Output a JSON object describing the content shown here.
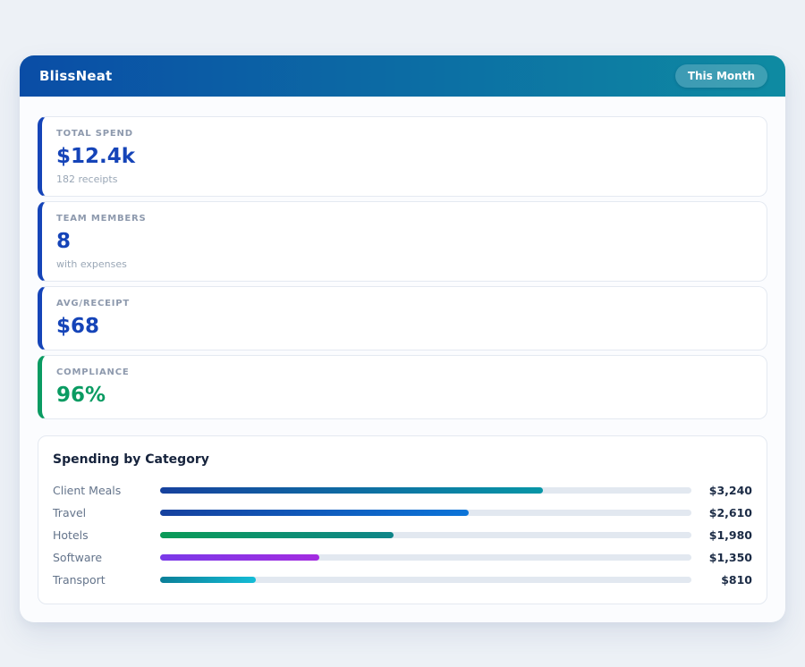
{
  "header": {
    "app_name": "BlissNeat",
    "badge": "This Month",
    "gradient_from": "#0a4da6",
    "gradient_to": "#0e8ba2"
  },
  "stats": [
    {
      "label": "TOTAL SPEND",
      "value": "$12.4k",
      "sub": "182 receipts",
      "accent": "#1544b8",
      "value_color": "#1544b8"
    },
    {
      "label": "TEAM MEMBERS",
      "value": "8",
      "sub": "with expenses",
      "accent": "#1544b8",
      "value_color": "#1544b8"
    },
    {
      "label": "AVG/RECEIPT",
      "value": "$68",
      "sub": "",
      "accent": "#1544b8",
      "value_color": "#1544b8"
    },
    {
      "label": "COMPLIANCE",
      "value": "96%",
      "sub": "",
      "accent": "#0a9b62",
      "value_color": "#0a9b62"
    }
  ],
  "spending": {
    "title": "Spending by Category",
    "max": 4500,
    "track_color": "#e2e8f0",
    "rows": [
      {
        "label": "Client Meals",
        "value": 3240,
        "value_label": "$3,240",
        "gradient": [
          "#16419e",
          "#0796a6"
        ]
      },
      {
        "label": "Travel",
        "value": 2610,
        "value_label": "$2,610",
        "gradient": [
          "#16419e",
          "#0b74d8"
        ]
      },
      {
        "label": "Hotels",
        "value": 1980,
        "value_label": "$1,980",
        "gradient": [
          "#0a9b57",
          "#0f8589"
        ]
      },
      {
        "label": "Software",
        "value": 1350,
        "value_label": "$1,350",
        "gradient": [
          "#7a3ae8",
          "#a32ce0"
        ]
      },
      {
        "label": "Transport",
        "value": 810,
        "value_label": "$810",
        "gradient": [
          "#0b7f98",
          "#14bcd6"
        ]
      }
    ]
  },
  "chart_data": {
    "type": "bar",
    "orientation": "horizontal",
    "title": "Spending by Category",
    "categories": [
      "Client Meals",
      "Travel",
      "Hotels",
      "Software",
      "Transport"
    ],
    "values": [
      3240,
      2610,
      1980,
      1350,
      810
    ],
    "value_labels": [
      "$3,240",
      "$2,610",
      "$1,980",
      "$1,350",
      "$810"
    ],
    "xlabel": "",
    "ylabel": "",
    "xlim": [
      0,
      4500
    ],
    "grid": false,
    "legend": false
  }
}
